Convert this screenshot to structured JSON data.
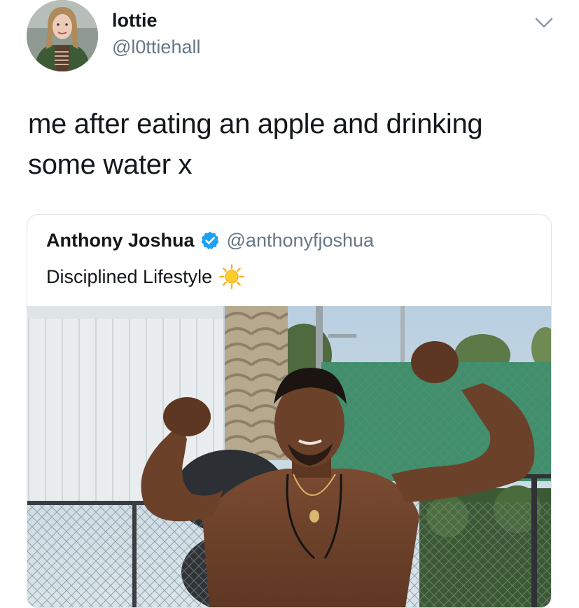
{
  "author": {
    "display_name": "lottie",
    "handle": "@l0ttiehall",
    "avatar_icon": "profile-photo"
  },
  "tweet": {
    "text_line1": "me after eating an apple and drinking",
    "text_line2": "some water x"
  },
  "quoted_tweet": {
    "display_name": "Anthony Joshua",
    "verified": true,
    "handle": "@anthonyfjoshua",
    "text": "Disciplined Lifestyle",
    "emoji_icon": "sun-icon",
    "photo_icon": "flexing-man-photo"
  },
  "colors": {
    "text_primary": "#14171a",
    "text_secondary": "#657786",
    "verified_blue": "#1da1f2",
    "card_border": "#dfe4e8"
  }
}
